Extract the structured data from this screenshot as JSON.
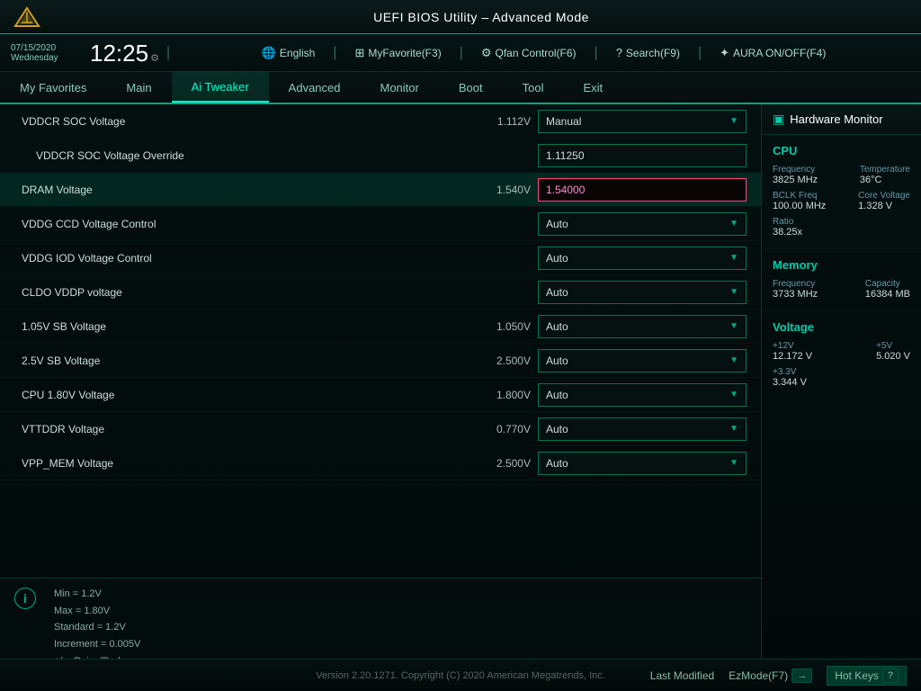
{
  "header": {
    "title": "UEFI BIOS Utility – Advanced Mode",
    "logo_alt": "ASUS Logo"
  },
  "datetime": {
    "date": "07/15/2020",
    "day": "Wednesday",
    "time": "12:25"
  },
  "controls": [
    {
      "label": "English",
      "icon": "🌐",
      "key": ""
    },
    {
      "label": "MyFavorite(F3)",
      "icon": "★",
      "key": "F3"
    },
    {
      "label": "Qfan Control(F6)",
      "icon": "⚙",
      "key": "F6"
    },
    {
      "label": "Search(F9)",
      "icon": "?",
      "key": "F9"
    },
    {
      "label": "AURA ON/OFF(F4)",
      "icon": "✦",
      "key": "F4"
    }
  ],
  "nav": {
    "items": [
      {
        "label": "My Favorites",
        "active": false
      },
      {
        "label": "Main",
        "active": false
      },
      {
        "label": "Ai Tweaker",
        "active": true
      },
      {
        "label": "Advanced",
        "active": false
      },
      {
        "label": "Monitor",
        "active": false
      },
      {
        "label": "Boot",
        "active": false
      },
      {
        "label": "Tool",
        "active": false
      },
      {
        "label": "Exit",
        "active": false
      }
    ]
  },
  "settings": [
    {
      "name": "VDDCR SOC Voltage",
      "indent": false,
      "value": "1.112V",
      "control_type": "dropdown",
      "control_value": "Manual"
    },
    {
      "name": "VDDCR SOC Voltage Override",
      "indent": true,
      "value": "",
      "control_type": "input",
      "control_value": "1.11250",
      "active": false
    },
    {
      "name": "DRAM Voltage",
      "indent": false,
      "value": "1.540V",
      "control_type": "input",
      "control_value": "1.54000",
      "active": true,
      "highlighted": true
    },
    {
      "name": "VDDG CCD Voltage Control",
      "indent": false,
      "value": "",
      "control_type": "dropdown",
      "control_value": "Auto"
    },
    {
      "name": "VDDG IOD Voltage Control",
      "indent": false,
      "value": "",
      "control_type": "dropdown",
      "control_value": "Auto"
    },
    {
      "name": "CLDO VDDP voltage",
      "indent": false,
      "value": "",
      "control_type": "dropdown",
      "control_value": "Auto"
    },
    {
      "name": "1.05V SB Voltage",
      "indent": false,
      "value": "1.050V",
      "control_type": "dropdown",
      "control_value": "Auto"
    },
    {
      "name": "2.5V SB Voltage",
      "indent": false,
      "value": "2.500V",
      "control_type": "dropdown",
      "control_value": "Auto"
    },
    {
      "name": "CPU 1.80V Voltage",
      "indent": false,
      "value": "1.800V",
      "control_type": "dropdown",
      "control_value": "Auto"
    },
    {
      "name": "VTTDDR Voltage",
      "indent": false,
      "value": "0.770V",
      "control_type": "dropdown",
      "control_value": "Auto"
    },
    {
      "name": "VPP_MEM Voltage",
      "indent": false,
      "value": "2.500V",
      "control_type": "dropdown",
      "control_value": "Auto"
    }
  ],
  "info": {
    "lines": [
      "Min    = 1.2V",
      "Max    = 1.80V",
      "Standard  = 1.2V",
      "Increment = 0.005V",
      "+/- : Raise/Reduce"
    ]
  },
  "hw_monitor": {
    "title": "Hardware Monitor",
    "sections": [
      {
        "title": "CPU",
        "rows": [
          [
            {
              "label": "Frequency",
              "value": "3825 MHz"
            },
            {
              "label": "Temperature",
              "value": "36°C"
            }
          ],
          [
            {
              "label": "BCLK Freq",
              "value": "100.00 MHz"
            },
            {
              "label": "Core Voltage",
              "value": "1.328 V"
            }
          ],
          [
            {
              "label": "Ratio",
              "value": "38.25x"
            },
            {
              "label": "",
              "value": ""
            }
          ]
        ]
      },
      {
        "title": "Memory",
        "rows": [
          [
            {
              "label": "Frequency",
              "value": "3733 MHz"
            },
            {
              "label": "Capacity",
              "value": "16384 MB"
            }
          ]
        ]
      },
      {
        "title": "Voltage",
        "rows": [
          [
            {
              "label": "+12V",
              "value": "12.172 V"
            },
            {
              "label": "+5V",
              "value": "5.020 V"
            }
          ],
          [
            {
              "label": "+3.3V",
              "value": "3.344 V"
            },
            {
              "label": "",
              "value": ""
            }
          ]
        ]
      }
    ]
  },
  "footer": {
    "version": "Version 2.20.1271. Copyright (C) 2020 American Megatrends, Inc.",
    "last_modified": "Last Modified",
    "ez_mode": "EzMode(F7)",
    "hot_keys": "Hot Keys"
  }
}
